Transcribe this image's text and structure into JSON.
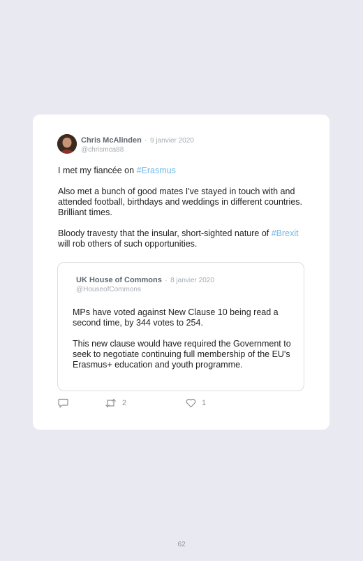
{
  "tweet": {
    "author_name": "Chris McAlinden",
    "separator": "·",
    "date": "9 janvier 2020",
    "handle": "@chrismca88",
    "paragraphs": {
      "p1_text": "I met my fiancée on ",
      "p1_hashtag": "#Erasmus",
      "p2_text": "Also met a bunch of good mates I've stayed in touch with and attended football, birthdays and weddings in different countries. Brilliant times.",
      "p3_text": "Bloody travesty that the insular, short-sighted nature of ",
      "p3_hashtag": "#Brexit",
      "p3_rest": " will rob others of such opportunities."
    },
    "actions": {
      "reply_icon": "reply-icon",
      "retweet_icon": "retweet-icon",
      "retweet_count": "2",
      "like_icon": "heart-icon",
      "like_count": "1"
    }
  },
  "quoted_tweet": {
    "author_name": "UK House of Commons",
    "separator": "·",
    "date": "8 janvier 2020",
    "handle": "@HouseofCommons",
    "p1": "MPs have voted against New Clause 10 being read a second time, by 344 votes to 254.",
    "p2": "This new clause would have required the Government to seek to negotiate continuing full membership of the EU's Erasmus+ education and youth programme."
  },
  "page": {
    "number": "62"
  },
  "colors": {
    "background": "#e9e9f2",
    "card": "#ffffff",
    "hashtag": "#6fb8e8",
    "muted": "#a7adb3"
  }
}
